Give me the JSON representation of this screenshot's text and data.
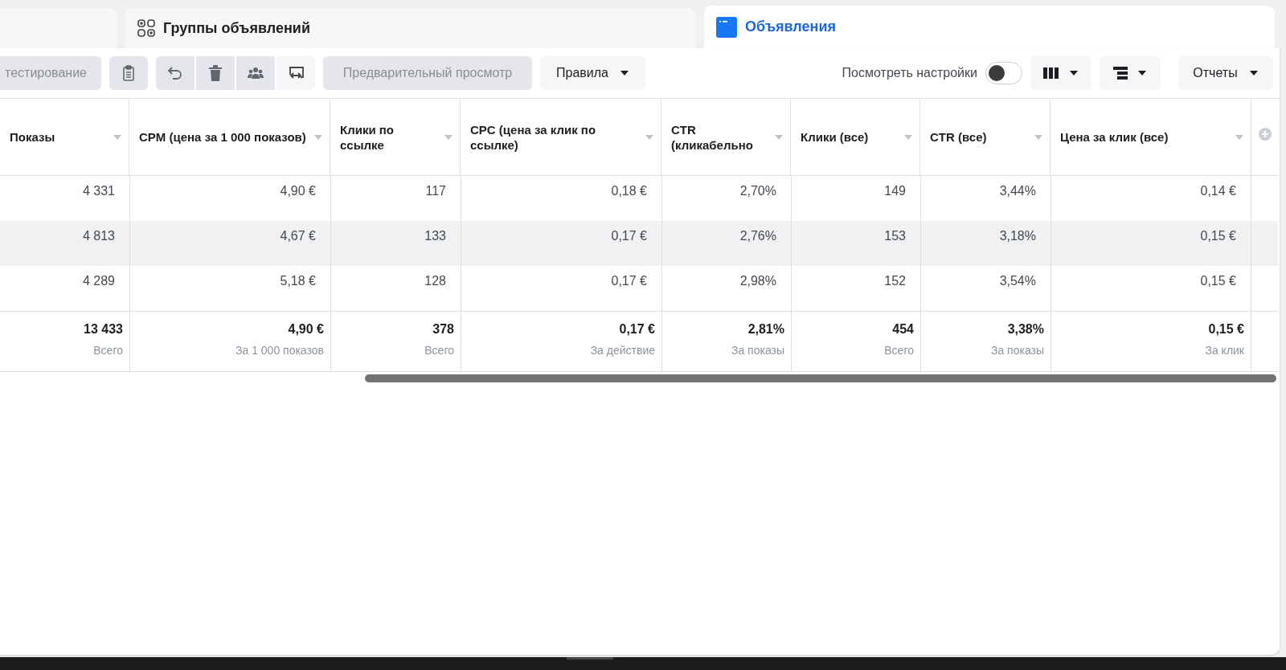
{
  "tabs": [
    {
      "kind": "ad_sets",
      "label": "Группы объявлений",
      "selected": false
    },
    {
      "kind": "ads",
      "label": "Объявления",
      "selected": true
    }
  ],
  "toolbar": {
    "partial_button": "тестирование",
    "preview_button": {
      "label": "Предварительный просмотр",
      "disabled": true
    },
    "rules_menu": "Правила",
    "view_settings": {
      "label": "Посмотреть настройки",
      "on": false
    },
    "reports_menu": "Отчеты"
  },
  "table": {
    "columns": [
      "Показы",
      "CPM (цена за 1 000 показов)",
      "Клики по ссылке",
      "CPC (цена за клик по ссылке)",
      "CTR (кликабельно",
      "Клики (все)",
      "CTR (все)",
      "Цена за клик (все)"
    ],
    "rows": [
      {
        "highlighted": false,
        "cells": [
          "4 331",
          "4,90 €",
          "117",
          "0,18 €",
          "2,70%",
          "149",
          "3,44%",
          "0,14 €"
        ]
      },
      {
        "highlighted": true,
        "cells": [
          "4 813",
          "4,67 €",
          "133",
          "0,17 €",
          "2,76%",
          "153",
          "3,18%",
          "0,15 €"
        ]
      },
      {
        "highlighted": false,
        "cells": [
          "4 289",
          "5,18 €",
          "128",
          "0,17 €",
          "2,98%",
          "152",
          "3,54%",
          "0,15 €"
        ]
      }
    ],
    "totals": [
      {
        "value": "13 433",
        "caption": "Всего"
      },
      {
        "value": "4,90 €",
        "caption": "За 1 000 показов"
      },
      {
        "value": "378",
        "caption": "Всего"
      },
      {
        "value": "0,17 €",
        "caption": "За действие"
      },
      {
        "value": "2,81%",
        "caption": "За показы"
      },
      {
        "value": "454",
        "caption": "Всего"
      },
      {
        "value": "3,38%",
        "caption": "За показы"
      },
      {
        "value": "0,15 €",
        "caption": "За клик"
      }
    ]
  }
}
